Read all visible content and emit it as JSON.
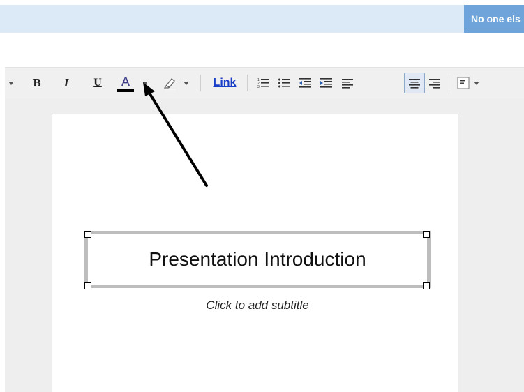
{
  "header": {
    "sharing_status": "No one els"
  },
  "toolbar": {
    "bold_label": "B",
    "italic_label": "I",
    "underline_label": "U",
    "font_color_label": "A",
    "link_label": "Link",
    "active_alignment": "center",
    "icons": [
      "caret-down-icon",
      "bold-icon",
      "italic-icon",
      "underline-icon",
      "font-color-icon",
      "highlight-icon",
      "numbered-list-icon",
      "bullet-list-icon",
      "decrease-indent-icon",
      "increase-indent-icon",
      "align-left-icon",
      "align-center-icon",
      "align-right-icon",
      "text-box-align-icon"
    ]
  },
  "slide": {
    "title": "Presentation Introduction",
    "subtitle_placeholder": "Click to add subtitle"
  },
  "colors": {
    "topbar": "#dce9f6",
    "sharing_badge": "#6ea4d9",
    "link": "#1a3fc7",
    "title_box_border": "#bdbdbd"
  }
}
